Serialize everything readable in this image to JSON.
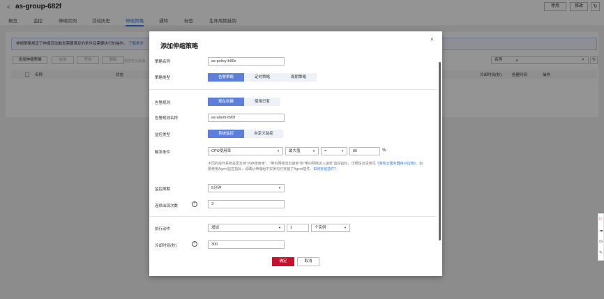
{
  "header": {
    "back": "<",
    "title": "as-group-682f",
    "disable_label": "停用",
    "edit_label": "修改",
    "refresh_icon": "↻"
  },
  "tabs": [
    {
      "label": "概览"
    },
    {
      "label": "监控"
    },
    {
      "label": "伸缩实例"
    },
    {
      "label": "活动历史"
    },
    {
      "label": "伸缩策略"
    },
    {
      "label": "通知"
    },
    {
      "label": "标签"
    },
    {
      "label": "生命周期挂钩"
    }
  ],
  "content": {
    "info_text": "伸缩策略规定了伸缩活动触发需要满足的条件及需要执行的操作。",
    "info_link": "了解更多",
    "buttons": {
      "add": "添加伸缩策略",
      "enable": "启用",
      "disable": "停用",
      "delete": "删除"
    },
    "hint": "您还可以添加",
    "search_select": "名称",
    "columns": {
      "name": "名称",
      "status": "状态",
      "cooldown": "冷却时间(秒)",
      "created": "创建时间",
      "ops": "操作"
    }
  },
  "modal": {
    "title": "添加伸缩策略",
    "close": "×",
    "policy_name_label": "策略名称",
    "policy_name_value": "as-policy-b90e",
    "policy_type_label": "策略类型",
    "policy_types": [
      "告警策略",
      "定时策略",
      "周期策略"
    ],
    "alarm_rule_label": "告警规则",
    "alarm_rule_options": [
      "现在创建",
      "使用已有"
    ],
    "alarm_rule_name_label": "告警规则名称",
    "alarm_rule_name_value": "as-alarm-b90f",
    "monitor_type_label": "监控类型",
    "monitor_type_options": [
      "系统监控",
      "自定义监控"
    ],
    "trigger_label": "触发条件",
    "trigger_metric": "CPU使用率",
    "trigger_agg": "最大值",
    "trigger_op": "=",
    "trigger_value": "80",
    "trigger_unit": "%",
    "note_text": "不同的操作系统是否支持\"内存使用率\"、\"带内网络流出速率\"和\"带内网络流入速率\"监控指标，详细信息请参见",
    "note_link1": "《弹性云服务器用户指南》",
    "note_text2": "。如要使用Agent监控指标，请确认伸缩组中实例均已安装了Agent插件。",
    "note_link2": "如何安装插件?",
    "period_label": "监控周期",
    "period_value": "5分钟",
    "times_label": "连续出现次数",
    "times_value": "3",
    "action_label": "执行动作",
    "action_value": "增加",
    "action_num": "1",
    "action_unit": "个实例",
    "cooldown_label": "冷却时间(秒)",
    "cooldown_value": "300",
    "ok_label": "确定",
    "cancel_label": "取消"
  },
  "side": {
    "icons": [
      "□",
      "☁",
      "◷",
      "✎"
    ]
  },
  "colors": {
    "primary": "#5c7fdc",
    "ok": "#c8102e",
    "link": "#3a7ee6"
  }
}
